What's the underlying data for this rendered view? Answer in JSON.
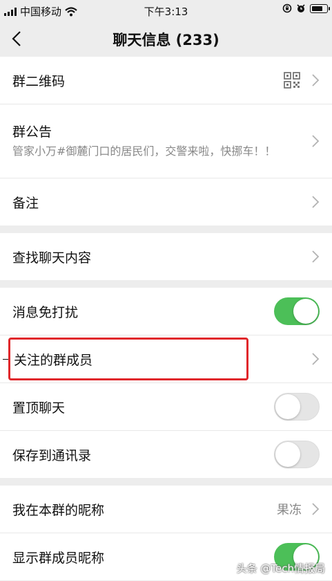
{
  "status_bar": {
    "carrier": "中国移动",
    "time": "下午3:13",
    "battery_level": 0.8
  },
  "navbar": {
    "title": "聊天信息 (233)",
    "back_icon": "chevron-left-icon"
  },
  "groups": {
    "info": {
      "qr_label": "群二维码",
      "announcement_label": "群公告",
      "announcement_text": "管家小万#御麓门口的居民们，交警来啦，快挪车！！",
      "remark_label": "备注"
    },
    "search": {
      "search_label": "查找聊天内容"
    },
    "settings": {
      "mute_label": "消息免打扰",
      "mute_on": true,
      "followed_label": "关注的群成员",
      "pin_label": "置顶聊天",
      "pin_on": false,
      "save_contacts_label": "保存到通讯录",
      "save_contacts_on": false
    },
    "nickname": {
      "my_nickname_label": "我在本群的昵称",
      "my_nickname_value": "果冻",
      "show_nickname_label": "显示群成员昵称",
      "show_nickname_on": true
    }
  },
  "watermark": "头条 @Tech情报局",
  "colors": {
    "toggle_on": "#4cbf58",
    "highlight": "#e0272b",
    "background": "#ededed"
  }
}
